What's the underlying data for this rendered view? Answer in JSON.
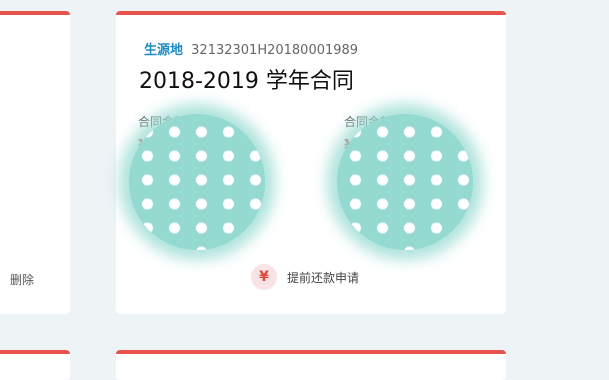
{
  "left_card": {
    "delete_label": "删除"
  },
  "main_card": {
    "tag": "生源地",
    "contract_id": "32132301H20180001989",
    "title": "2018-2019 学年合同",
    "amounts": [
      {
        "label": "合同金额",
        "currency_symbol": "¥"
      },
      {
        "label": "合同金额",
        "currency_symbol": "¥"
      }
    ],
    "apply_button": {
      "icon": "yen-icon",
      "label": "提前还款申请"
    }
  },
  "colors": {
    "accent_red": "#e9534f",
    "tag_blue": "#1f8bc5",
    "mask_teal": "#94dad0",
    "background": "#eef3f6"
  }
}
